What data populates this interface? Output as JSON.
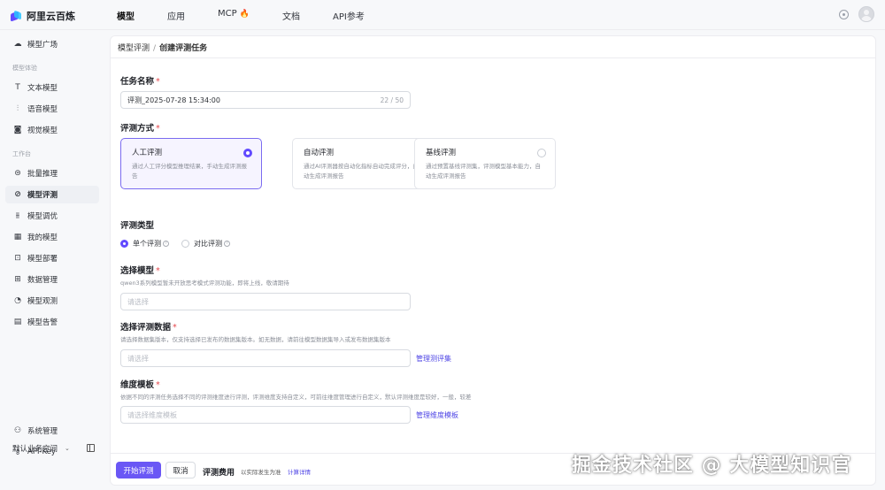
{
  "brand": {
    "name": "阿里云百炼"
  },
  "nav": {
    "items": [
      "模型",
      "应用",
      "MCP",
      "文档",
      "API参考"
    ],
    "active": "模型",
    "mcp_badge": "🔥"
  },
  "sidebar": {
    "top_item": "模型广场",
    "group_experience": "模型体验",
    "experience_items": [
      "文本模型",
      "语音模型",
      "视觉模型"
    ],
    "group_workbench": "工作台",
    "workbench_items": [
      "批量推理",
      "模型评测",
      "模型调优",
      "我的模型",
      "模型部署",
      "数据管理",
      "模型观测",
      "模型告警"
    ],
    "active_item": "模型评测",
    "bottom_items": [
      "系统管理",
      "API-Key"
    ],
    "workspace": "默认业务空间"
  },
  "breadcrumb": {
    "parent": "模型评测",
    "separator": "/",
    "current": "创建评测任务"
  },
  "form": {
    "task_name_label": "任务名称",
    "required_mark": "*",
    "task_name_value": "评测_2025-07-28 15:34:00",
    "task_name_counter": "22 / 50",
    "method_label": "评测方式",
    "methods": [
      {
        "title": "人工评测",
        "desc": "通过人工评分模型推理结果，手动生成评测报告",
        "selected": true
      },
      {
        "title": "自动评测",
        "desc": "通过AI评测器按自动化指标自动完成评分，自动生成评测报告",
        "selected": false
      },
      {
        "title": "基线评测",
        "desc": "通过预置基线评测集，评测模型基本能力，自动生成评测报告",
        "selected": false
      }
    ],
    "type_label": "评测类型",
    "type_options": [
      {
        "label": "单个评测",
        "selected": true
      },
      {
        "label": "对比评测",
        "selected": false
      }
    ],
    "model_label": "选择模型",
    "model_hint": "qwen3系列模型暂未开放思考模式评测功能，即将上线，敬请期待",
    "model_placeholder": "请选择",
    "dataset_label": "选择评测数据",
    "dataset_hint": "请选择数据集版本，仅支持选择已发布的数据集版本。如无数据，请前往模型数据集导入或发布数据集版本",
    "dataset_placeholder": "请选择",
    "dataset_link": "管理测评集",
    "dimension_label": "维度模板",
    "dimension_hint": "依据不同的评测任务选择不同的评测维度进行评测，评测维度支持自定义，可前往维度管理进行自定义，默认评测维度是较好，一般，较差",
    "dimension_placeholder": "请选择维度模板",
    "dimension_link": "管理维度模板"
  },
  "footer": {
    "start_button": "开始评测",
    "cancel_button": "取消",
    "fee_label": "评测费用",
    "fee_note": "以实际发生为准",
    "fee_link": "计算详情"
  },
  "watermark": "掘金技术社区 @ 大模型知识官",
  "colors": {
    "accent": "#624aff",
    "link": "#4f46e5",
    "required": "#e5484d"
  }
}
